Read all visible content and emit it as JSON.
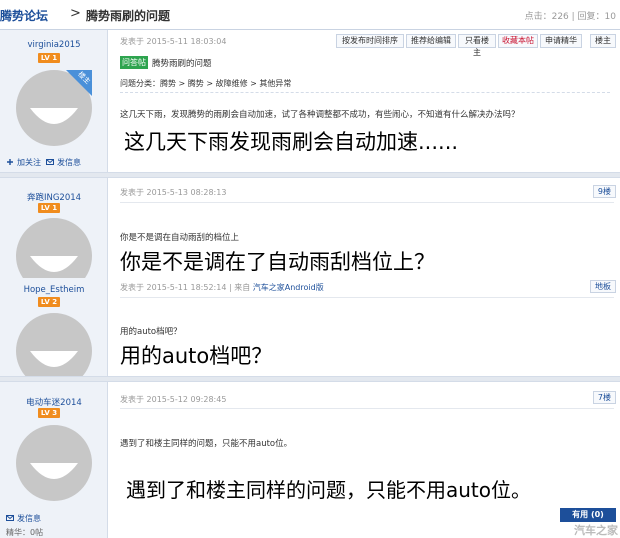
{
  "header": {
    "forum": "腾势论坛",
    "separator": ">",
    "thread_title": "腾势雨刷的问题",
    "stats": "点击：226 | 回复：10"
  },
  "toolbar": {
    "sort_time": "按发布时间排序",
    "recommend_editor": "推荐给编辑",
    "only_op": "只看楼主",
    "favorite": "收藏本帖",
    "apply_featured": "申请精华",
    "op_floor": "楼主"
  },
  "posts": [
    {
      "username": "virginia2015",
      "level": "LV 1",
      "op_badge": "楼主",
      "follow": "加关注",
      "message": "发信息",
      "meta": "发表于 2015-5-11 18:03:04",
      "tag": "问答帖",
      "title": "腾势雨刷的问题",
      "category": "问题分类：腾势 > 腾势 > 故障维修 > 其他异常",
      "body": "这几天下雨，发现腾势的雨刷会自动加速，试了各种调整都不成功，有些闹心，不知道有什么解决办法吗？",
      "caption": "这几天下雨发现雨刷会自动加速......"
    },
    {
      "username": "奔跑ING2014",
      "level": "LV 1",
      "meta": "发表于 2015-5-13 08:28:13",
      "floor": "9楼",
      "body": "你是不是调在自动雨刮的档位上",
      "caption": "你是不是调在了自动雨刮档位上？"
    },
    {
      "username": "Hope_Estheim",
      "level": "LV 2",
      "meta": "发表于 2015-5-11 18:52:14",
      "meta_from": "| 来自",
      "meta_src": "汽车之家Android版",
      "floor": "地板",
      "body": "用的auto档吧？",
      "caption": "用的auto档吧？"
    },
    {
      "username": "电动车迷2014",
      "level": "LV 3",
      "meta": "发表于 2015-5-12 09:28:45",
      "floor": "7楼",
      "body": "遇到了和楼主同样的问题，只能不用auto位。",
      "caption": "遇到了和楼主同样的问题，只能不用auto位。",
      "message": "发信息",
      "essence": "精华：0帖"
    }
  ],
  "useful_button": "有用 (0)",
  "watermark": "汽车之家",
  "colors": {
    "link_blue": "#1d4f9a",
    "level_orange": "#f08c1e",
    "op_blue": "#4a90d9",
    "green_tag": "#2ea44f",
    "favorite_red": "#c8102e"
  }
}
